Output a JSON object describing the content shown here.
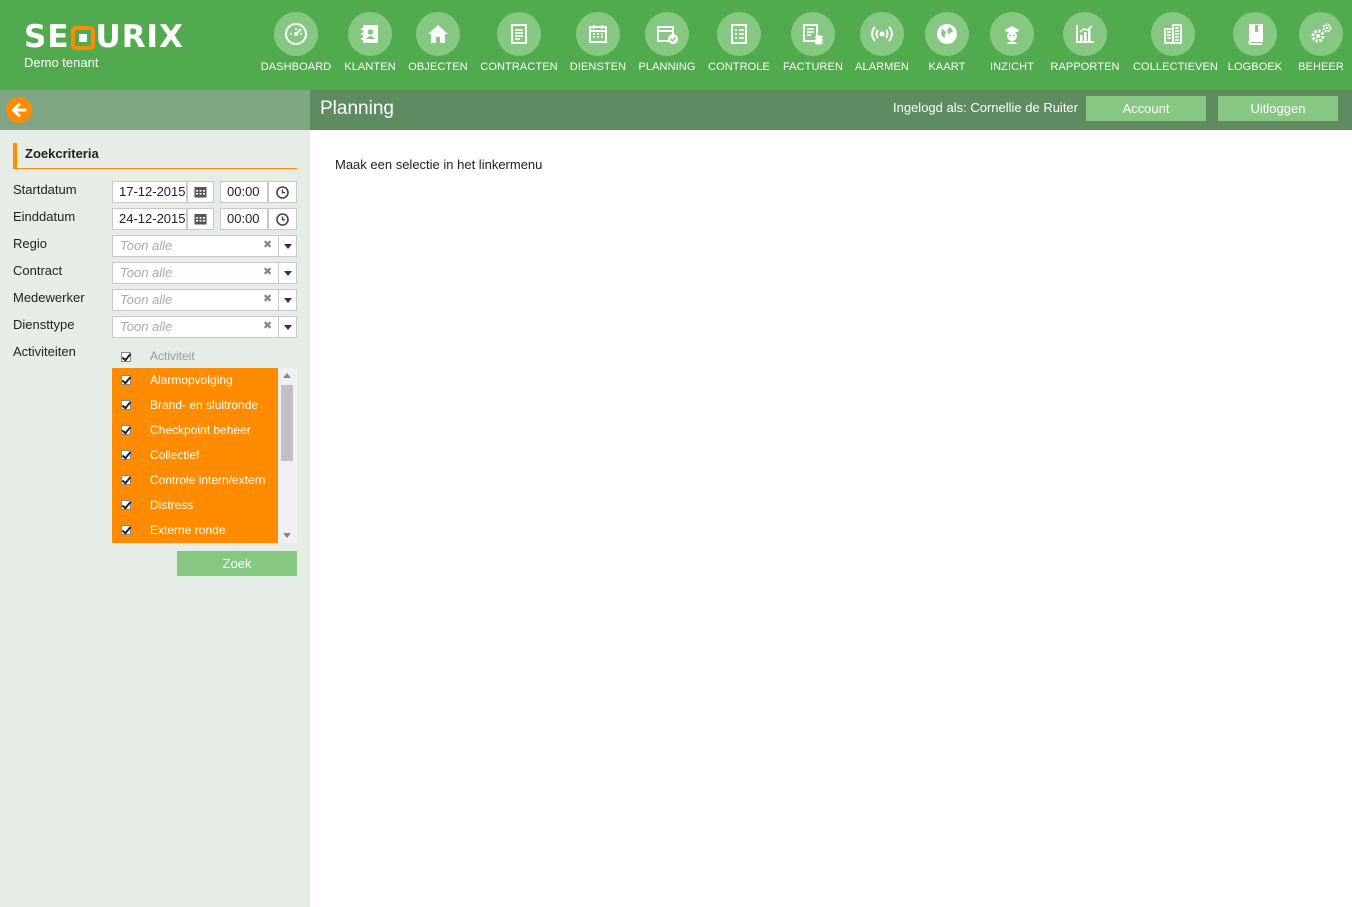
{
  "brand": {
    "logo_left": "SE",
    "logo_right": "URIX",
    "tenant": "Demo tenant"
  },
  "nav": [
    {
      "label": "DASHBOARD",
      "icon": "dashboard-icon"
    },
    {
      "label": "KLANTEN",
      "icon": "contacts-icon"
    },
    {
      "label": "OBJECTEN",
      "icon": "home-icon"
    },
    {
      "label": "CONTRACTEN",
      "icon": "contract-icon"
    },
    {
      "label": "DIENSTEN",
      "icon": "calendar-icon"
    },
    {
      "label": "PLANNING",
      "icon": "planning-icon"
    },
    {
      "label": "CONTROLE",
      "icon": "checklist-icon"
    },
    {
      "label": "FACTUREN",
      "icon": "invoice-icon"
    },
    {
      "label": "ALARMEN",
      "icon": "alarm-icon"
    },
    {
      "label": "KAART",
      "icon": "globe-icon"
    },
    {
      "label": "INZICHT",
      "icon": "guard-icon"
    },
    {
      "label": "RAPPORTEN",
      "icon": "chart-icon"
    },
    {
      "label": "COLLECTIEVEN",
      "icon": "building-icon"
    },
    {
      "label": "LOGBOEK",
      "icon": "book-icon"
    },
    {
      "label": "BEHEER",
      "icon": "gears-icon"
    }
  ],
  "header": {
    "title": "Planning",
    "logged_in": "Ingelogd als: Cornellie de Ruiter",
    "account_label": "Account",
    "logout_label": "Uitloggen"
  },
  "sidebar": {
    "section_title": "Zoekcriteria",
    "startdatum": {
      "label": "Startdatum",
      "date": "17-12-2015",
      "time": "00:00"
    },
    "einddatum": {
      "label": "Einddatum",
      "date": "24-12-2015",
      "time": "00:00"
    },
    "filters": [
      {
        "label": "Regio",
        "placeholder": "Toon alle"
      },
      {
        "label": "Contract",
        "placeholder": "Toon alle"
      },
      {
        "label": "Medewerker",
        "placeholder": "Toon alle"
      },
      {
        "label": "Diensttype",
        "placeholder": "Toon alle"
      }
    ],
    "clear_symbol": "✖",
    "activities_label": "Activiteiten",
    "activities_header": "Activiteit",
    "activities": [
      {
        "label": "Alarmopvolging",
        "checked": true
      },
      {
        "label": "Brand- en sluitronde",
        "checked": true
      },
      {
        "label": "Checkpoint beheer",
        "checked": true
      },
      {
        "label": "Collectief",
        "checked": true
      },
      {
        "label": "Controle intern/extern",
        "checked": true
      },
      {
        "label": "Distress",
        "checked": true
      },
      {
        "label": "Externe ronde",
        "checked": true
      }
    ],
    "search_label": "Zoek"
  },
  "main": {
    "message": "Maak een selectie in het linkermenu"
  },
  "colors": {
    "topbar": "#52aa4f",
    "nav_circle": "#86c882",
    "accent": "#ff8c00",
    "subbar_left": "#7fa582",
    "subbar_right": "#5e8c60",
    "sidebar": "#e6ece6"
  }
}
